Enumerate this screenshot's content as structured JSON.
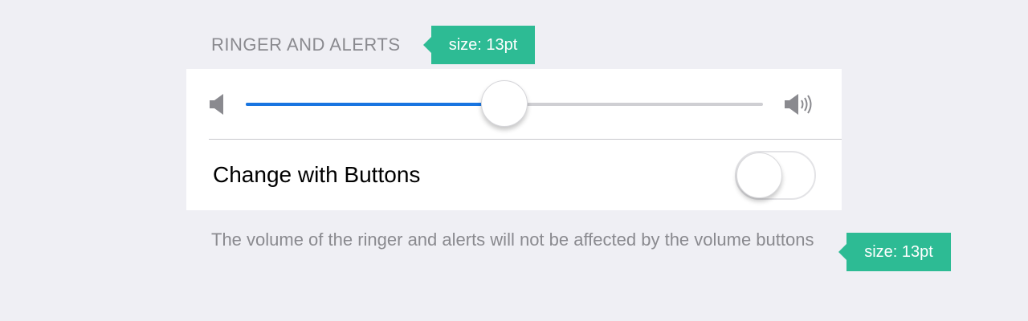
{
  "section": {
    "header": "RINGER AND ALERTS",
    "header_annotation": "size: 13pt"
  },
  "volume": {
    "low_icon": "speaker-low-icon",
    "high_icon": "speaker-high-icon",
    "level_fraction": 0.5,
    "fill_color": "#1875e1"
  },
  "change_with_buttons": {
    "label": "Change with Buttons",
    "enabled": false
  },
  "footer": {
    "text": "The volume of the ringer and alerts will not be affected by the volume buttons",
    "annotation": "size: 13pt"
  },
  "colors": {
    "background": "#efeff4",
    "annotation_tag": "#2dbb94",
    "secondary_text": "#8a8a8f"
  }
}
